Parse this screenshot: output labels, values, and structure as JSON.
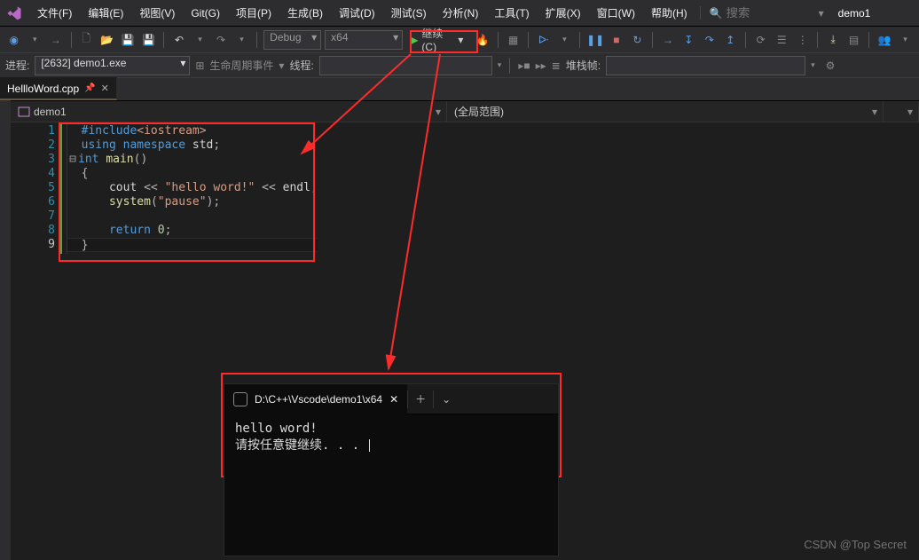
{
  "menubar": {
    "items": [
      "文件(F)",
      "编辑(E)",
      "视图(V)",
      "Git(G)",
      "项目(P)",
      "生成(B)",
      "调试(D)",
      "测试(S)",
      "分析(N)",
      "工具(T)",
      "扩展(X)",
      "窗口(W)",
      "帮助(H)"
    ],
    "search_placeholder": "搜索",
    "project": "demo1"
  },
  "toolbar": {
    "nav_back": "←",
    "nav_fwd": "→",
    "config": "Debug",
    "platform": "x64",
    "continue_label": "继续(C)",
    "continue_dd": "▾"
  },
  "procbar": {
    "label_process": "进程:",
    "process": "[2632] demo1.exe",
    "lifecycle": "生命周期事件",
    "label_thread": "线程:",
    "label_stack": "堆栈帧:"
  },
  "tabs": {
    "file": "HellloWord.cpp"
  },
  "scope": {
    "left": "demo1",
    "right": "(全局范围)"
  },
  "code": {
    "lines": [
      "#include<iostream>",
      "using namespace std;",
      "int main()",
      "{",
      "    cout << \"hello word!\" << endl;",
      "    system(\"pause\");",
      "",
      "    return 0;",
      "}"
    ],
    "line_numbers": [
      "1",
      "2",
      "3",
      "4",
      "5",
      "6",
      "7",
      "8",
      "9"
    ]
  },
  "console": {
    "title": "D:\\C++\\Vscode\\demo1\\x64",
    "lines": [
      "hello word!",
      "请按任意键继续. . . "
    ]
  },
  "watermark": "CSDN @Top Secret"
}
